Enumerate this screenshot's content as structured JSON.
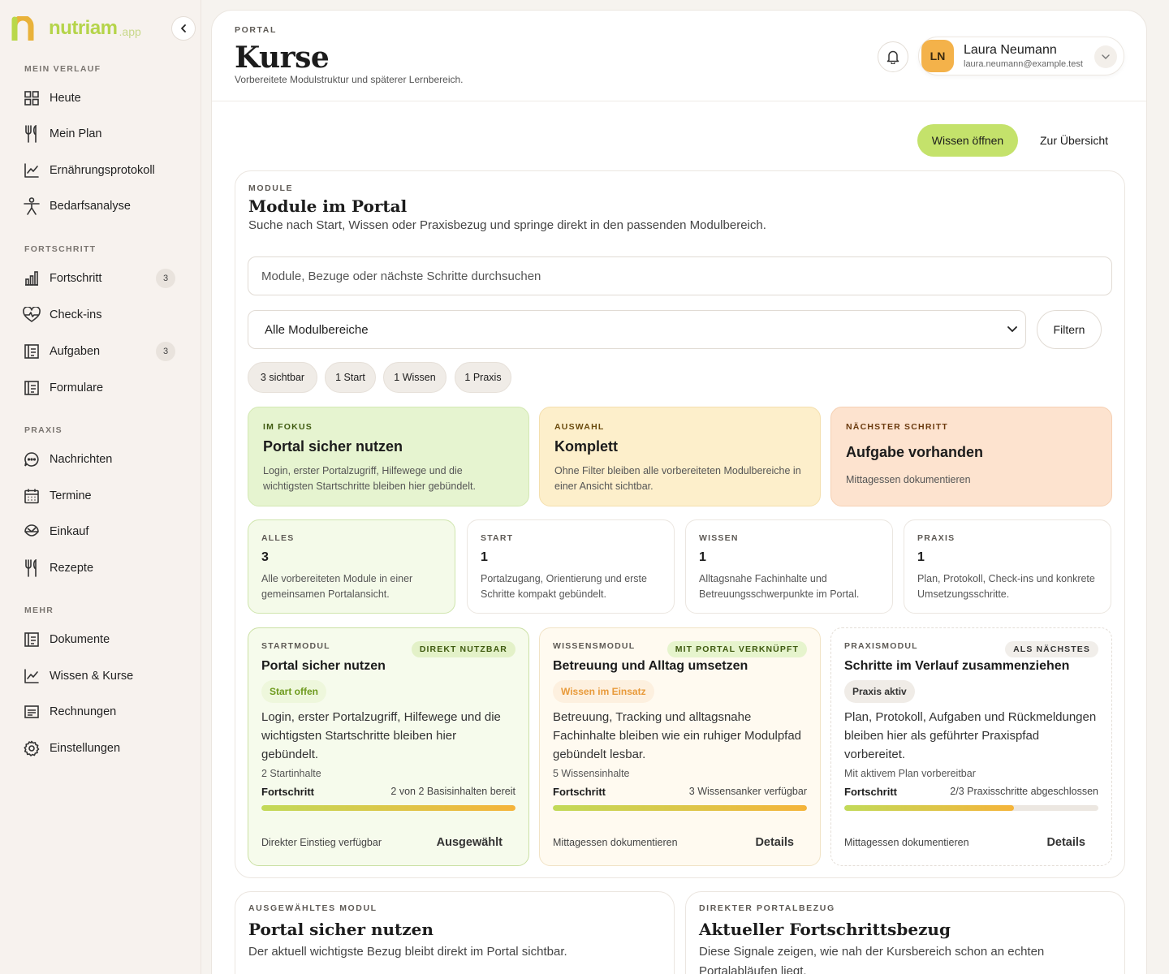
{
  "brand": {
    "name": "nutriam",
    "suffix": ".app"
  },
  "sidebar": {
    "sections": [
      {
        "label": "MEIN VERLAUF",
        "items": [
          {
            "label": "Heute",
            "icon": "grid-icon"
          },
          {
            "label": "Mein Plan",
            "icon": "cutlery-icon"
          },
          {
            "label": "Ernährungsprotokoll",
            "icon": "trend-chart-icon"
          },
          {
            "label": "Bedarfsanalyse",
            "icon": "person-icon"
          }
        ]
      },
      {
        "label": "FORTSCHRITT",
        "items": [
          {
            "label": "Fortschritt",
            "icon": "bar-chart-icon",
            "badge": "3"
          },
          {
            "label": "Check-ins",
            "icon": "heart-pulse-icon"
          },
          {
            "label": "Aufgaben",
            "icon": "list-icon",
            "badge": "3"
          },
          {
            "label": "Formulare",
            "icon": "form-icon"
          }
        ]
      },
      {
        "label": "PRAXIS",
        "items": [
          {
            "label": "Nachrichten",
            "icon": "chat-icon"
          },
          {
            "label": "Termine",
            "icon": "calendar-icon"
          },
          {
            "label": "Einkauf",
            "icon": "basket-icon"
          },
          {
            "label": "Rezepte",
            "icon": "cutlery-icon"
          }
        ]
      },
      {
        "label": "MEHR",
        "items": [
          {
            "label": "Dokumente",
            "icon": "document-icon"
          },
          {
            "label": "Wissen & Kurse",
            "icon": "trend-chart-icon"
          },
          {
            "label": "Rechnungen",
            "icon": "invoice-icon"
          },
          {
            "label": "Einstellungen",
            "icon": "gear-icon"
          }
        ]
      }
    ]
  },
  "header": {
    "eyebrow": "PORTAL",
    "title": "Kurse",
    "subtitle": "Vorbereitete Modulstruktur und späterer Lernbereich."
  },
  "user": {
    "initials": "LN",
    "name": "Laura Neumann",
    "email": "laura.neumann@example.test"
  },
  "actions": {
    "primary": "Wissen öffnen",
    "secondary": "Zur Übersicht"
  },
  "modules": {
    "eyebrow": "MODULE",
    "title": "Module im Portal",
    "subtitle": "Suche nach Start, Wissen oder Praxisbezug und springe direkt in den passenden Modulbereich.",
    "search_placeholder": "Module, Bezuge oder nächste Schritte durchsuchen",
    "select_value": "Alle Modulbereiche",
    "filter_label": "Filtern",
    "chips": [
      "3 sichtbar",
      "1 Start",
      "1 Wissen",
      "1 Praxis"
    ],
    "highlights": [
      {
        "kicker": "IM FOKUS",
        "title": "Portal sicher nutzen",
        "desc": "Login, erster Portalzugriff, Hilfewege und die wichtigsten Startschritte bleiben hier gebündelt."
      },
      {
        "kicker": "AUSWAHL",
        "title": "Komplett",
        "desc": "Ohne Filter bleiben alle vorbereiteten Modulbereiche in einer Ansicht sichtbar."
      },
      {
        "kicker": "NÄCHSTER SCHRITT",
        "title": "Aufgabe vorhanden",
        "desc": "Mittagessen dokumentieren"
      }
    ],
    "stats": [
      {
        "kicker": "ALLES",
        "count": "3",
        "desc": "Alle vorbereiteten Module in einer gemeinsamen Portalansicht."
      },
      {
        "kicker": "START",
        "count": "1",
        "desc": "Portalzugang, Orientierung und erste Schritte kompakt gebündelt."
      },
      {
        "kicker": "WISSEN",
        "count": "1",
        "desc": "Alltagsnahe Fachinhalte und Betreuungsschwerpunkte im Portal."
      },
      {
        "kicker": "PRAXIS",
        "count": "1",
        "desc": "Plan, Protokoll, Check-ins und konkrete Umsetzungsschritte."
      }
    ],
    "cards": [
      {
        "kicker": "STARTMODUL",
        "tag": "DIREKT NUTZBAR",
        "title": "Portal sicher nutzen",
        "status": "Start offen",
        "desc": "Login, erster Portalzugriff, Hilfewege und die wichtigsten Startschritte bleiben hier gebündelt.",
        "count": "2 Startinhalte",
        "progress_label": "Fortschritt",
        "progress_text": "2 von 2 Basisinhalten bereit",
        "progress": 1.0,
        "footer": "Direkter Einstieg verfügbar",
        "action": "Ausgewählt"
      },
      {
        "kicker": "WISSENSMODUL",
        "tag": "MIT PORTAL VERKNÜPFT",
        "title": "Betreuung und Alltag umsetzen",
        "status": "Wissen im Einsatz",
        "desc": "Betreuung, Tracking und alltagsnahe Fachinhalte bleiben wie ein ruhiger Modulpfad gebündelt lesbar.",
        "count": "5 Wissensinhalte",
        "progress_label": "Fortschritt",
        "progress_text": "3 Wissensanker verfügbar",
        "progress": 1.0,
        "footer": "Mittagessen dokumentieren",
        "action": "Details"
      },
      {
        "kicker": "PRAXISMODUL",
        "tag": "ALS NÄCHSTES",
        "title": "Schritte im Verlauf zusammenziehen",
        "status": "Praxis aktiv",
        "desc": "Plan, Protokoll, Aufgaben und Rückmeldungen bleiben hier als geführter Praxispfad vorbereitet.",
        "count": "Mit aktivem Plan vorbereitbar",
        "progress_label": "Fortschritt",
        "progress_text": "2/3 Praxisschritte abgeschlossen",
        "progress": 0.667,
        "footer": "Mittagessen dokumentieren",
        "action": "Details"
      }
    ]
  },
  "bottom": [
    {
      "kicker": "AUSGEWÄHLTES MODUL",
      "title": "Portal sicher nutzen",
      "desc": "Der aktuell wichtigste Bezug bleibt direkt im Portal sichtbar."
    },
    {
      "kicker": "DIREKTER PORTALBEZUG",
      "title": "Aktueller Fortschrittsbezug",
      "desc": "Diese Signale zeigen, wie nah der Kursbereich schon an echten Portalabläufen liegt."
    }
  ],
  "colors": {
    "accent": "#c4e26b",
    "green_card": "#e7f5d1",
    "yellow_card": "#fdefcc",
    "orange_card": "#fde3cf"
  }
}
